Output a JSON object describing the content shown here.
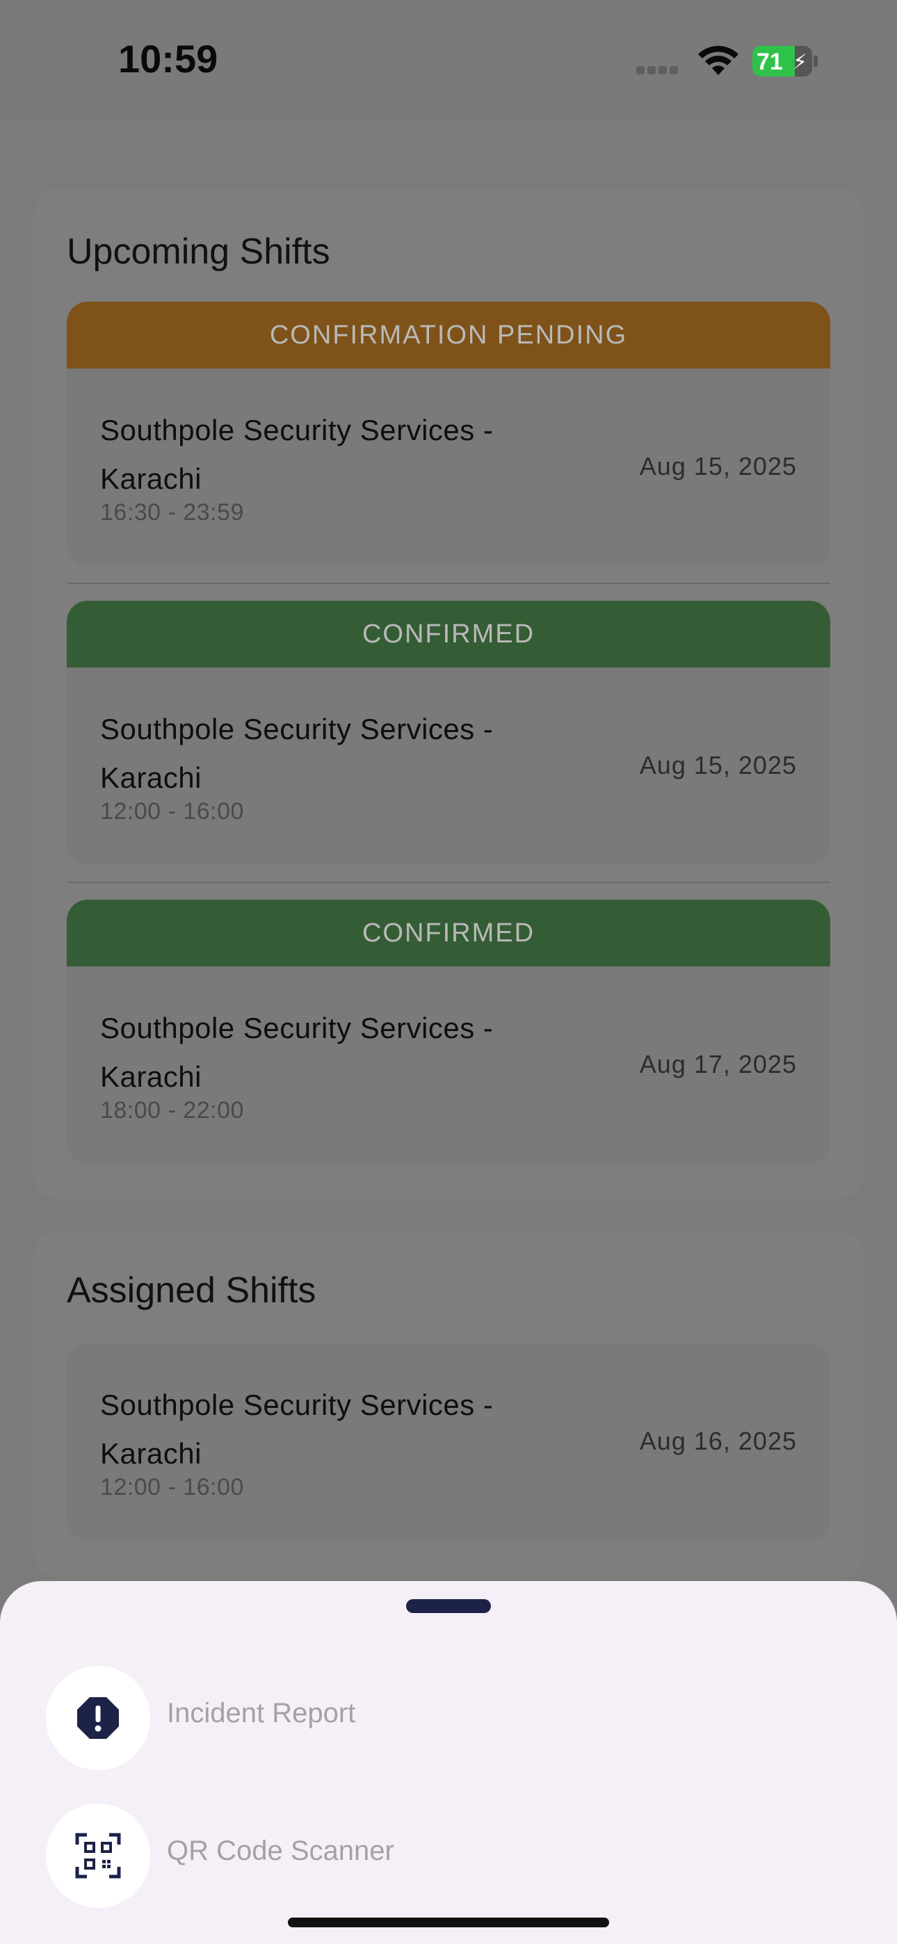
{
  "status_bar": {
    "time": "10:59",
    "battery_percent": "71",
    "battery_level": 0.71,
    "battery_color": "#2ec24a"
  },
  "upcoming": {
    "title": "Upcoming Shifts",
    "shifts": [
      {
        "status": "CONFIRMATION PENDING",
        "company": "Southpole Security Services - Karachi",
        "hours": "16:30 - 23:59",
        "date": "Aug 15, 2025"
      },
      {
        "status": "CONFIRMED",
        "company": "Southpole Security Services - Karachi",
        "hours": "12:00 - 16:00",
        "date": "Aug 15, 2025"
      },
      {
        "status": "CONFIRMED",
        "company": "Southpole Security Services - Karachi",
        "hours": "18:00 - 22:00",
        "date": "Aug 17, 2025"
      }
    ]
  },
  "assigned": {
    "title": "Assigned Shifts",
    "shifts": [
      {
        "company": "Southpole Security Services - Karachi",
        "hours": "12:00 - 16:00",
        "date": "Aug 16, 2025"
      }
    ]
  },
  "sheet": {
    "actions": [
      {
        "label": "Incident Report",
        "icon": "alert-octagon-icon"
      },
      {
        "label": "QR Code Scanner",
        "icon": "qr-code-icon"
      }
    ]
  },
  "colors": {
    "pending": "#7e5218",
    "confirmed": "#355d35",
    "icon": "#1c2347"
  }
}
